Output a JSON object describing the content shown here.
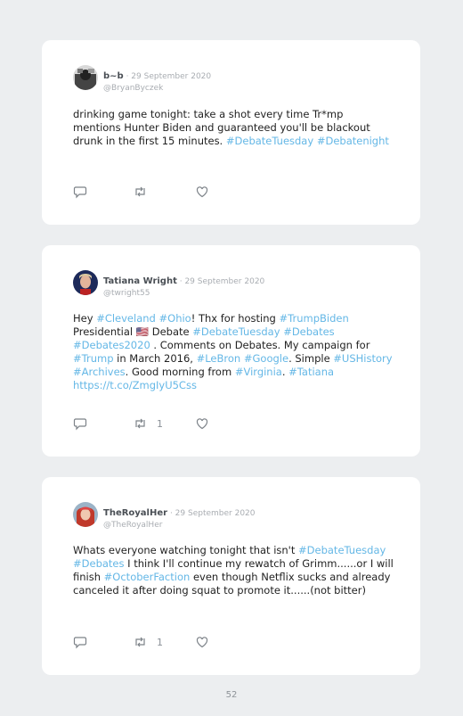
{
  "tweets": [
    {
      "name": "b~b",
      "date": "29 September 2020",
      "handle": "@BryanByczek",
      "text_parts": [
        {
          "t": "drinking game tonight: take a shot every time Tr*mp mentions Hunter Biden and guaranteed you'll be blackout drunk in the first 15 minutes. "
        },
        {
          "t": "#DebateTuesday",
          "tag": true
        },
        {
          "t": " "
        },
        {
          "t": "#Debatenight",
          "tag": true
        }
      ],
      "retweets": "",
      "avatar_color": "#555555"
    },
    {
      "name": "Tatiana Wright",
      "date": "29 September 2020",
      "handle": "@twright55",
      "text_parts": [
        {
          "t": "Hey "
        },
        {
          "t": "#Cleveland",
          "tag": true
        },
        {
          "t": " "
        },
        {
          "t": "#Ohio",
          "tag": true
        },
        {
          "t": "! Thx for hosting "
        },
        {
          "t": "#TrumpBiden",
          "tag": true
        },
        {
          "t": " Presidential 🇺🇸 Debate "
        },
        {
          "t": "#DebateTuesday",
          "tag": true
        },
        {
          "t": " "
        },
        {
          "t": "#Debates",
          "tag": true
        },
        {
          "t": " "
        },
        {
          "t": "#Debates2020",
          "tag": true
        },
        {
          "t": " . Comments on Debates. My campaign for "
        },
        {
          "t": "#Trump",
          "tag": true
        },
        {
          "t": " in March 2016, "
        },
        {
          "t": "#LeBron",
          "tag": true
        },
        {
          "t": " "
        },
        {
          "t": "#Google",
          "tag": true
        },
        {
          "t": ". Simple "
        },
        {
          "t": "#USHistory",
          "tag": true
        },
        {
          "t": " "
        },
        {
          "t": "#Archives",
          "tag": true
        },
        {
          "t": ". Good morning from "
        },
        {
          "t": "#Virginia",
          "tag": true
        },
        {
          "t": ". "
        },
        {
          "t": "#Tatiana",
          "tag": true
        },
        {
          "t": " "
        },
        {
          "t": "https://t.co/ZmgIyU5Css",
          "tag": true
        }
      ],
      "retweets": "1",
      "avatar_color": "#1d2a5a"
    },
    {
      "name": "TheRoyalHer",
      "date": "29 September 2020",
      "handle": "@TheRoyalHer",
      "text_parts": [
        {
          "t": "Whats everyone watching tonight that isn't "
        },
        {
          "t": "#DebateTuesday",
          "tag": true
        },
        {
          "t": " "
        },
        {
          "t": "#Debates",
          "tag": true
        },
        {
          "t": " I think I'll continue my rewatch of Grimm......or I will finish "
        },
        {
          "t": "#OctoberFaction",
          "tag": true
        },
        {
          "t": " even though Netflix sucks and already canceled it after doing squat to promote it......(not bitter)"
        }
      ],
      "retweets": "1",
      "avatar_color": "#c0392b"
    }
  ],
  "separator": " · ",
  "page_number": "52",
  "colors": {
    "hashtag": "#64b7e6",
    "background": "#eceef0",
    "card": "#ffffff"
  },
  "icons": [
    "reply-icon",
    "retweet-icon",
    "like-icon"
  ]
}
